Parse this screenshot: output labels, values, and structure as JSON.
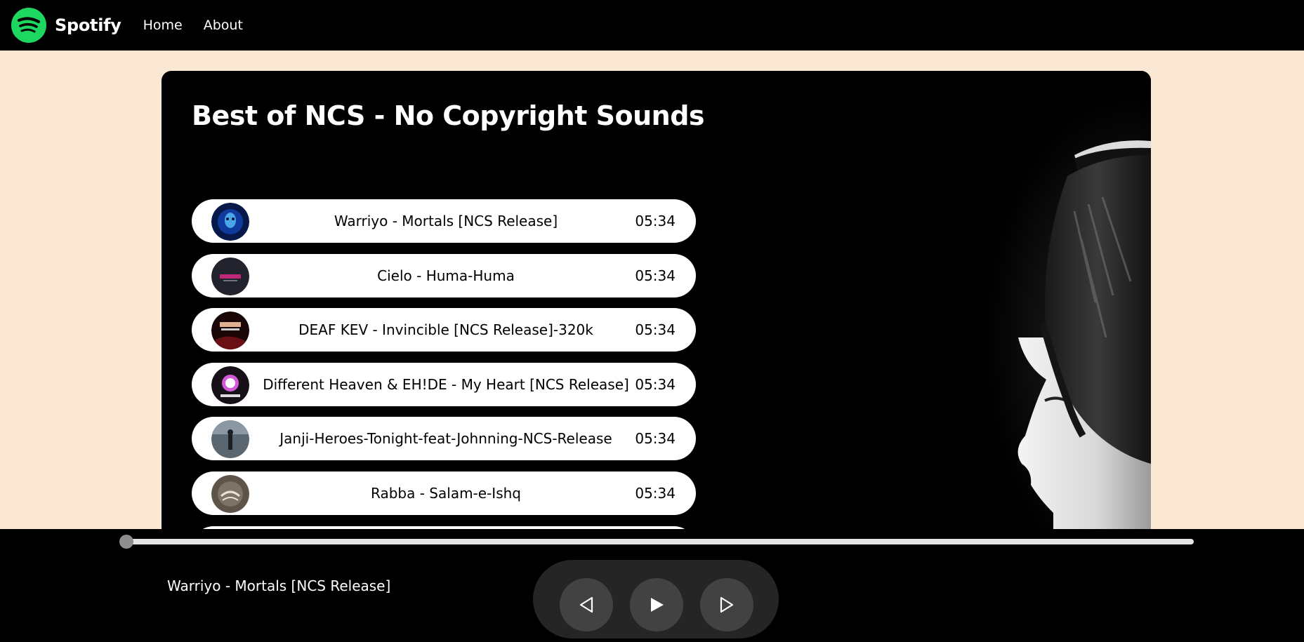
{
  "nav": {
    "brand": "Spotify",
    "links": [
      "Home",
      "About"
    ]
  },
  "playlist": {
    "title": "Best of NCS - No Copyright Sounds",
    "songs": [
      {
        "name": "Warriyo - Mortals [NCS Release]",
        "duration": "05:34"
      },
      {
        "name": "Cielo - Huma-Huma",
        "duration": "05:34"
      },
      {
        "name": "DEAF KEV - Invincible [NCS Release]-320k",
        "duration": "05:34"
      },
      {
        "name": "Different Heaven & EH!DE - My Heart [NCS Release]",
        "duration": "05:34"
      },
      {
        "name": "Janji-Heroes-Tonight-feat-Johnning-NCS-Release",
        "duration": "05:34"
      },
      {
        "name": "Rabba - Salam-e-Ishq",
        "duration": "05:34"
      }
    ]
  },
  "player": {
    "now_playing": "Warriyo - Mortals [NCS Release]",
    "progress": 0,
    "icons": [
      "previous-icon",
      "play-icon",
      "next-icon"
    ]
  },
  "colors": {
    "brand_green": "#1ed760",
    "page_background": "#fae8d5",
    "nav_background": "#000000",
    "control_pill": "#252525",
    "control_button": "#424242"
  }
}
